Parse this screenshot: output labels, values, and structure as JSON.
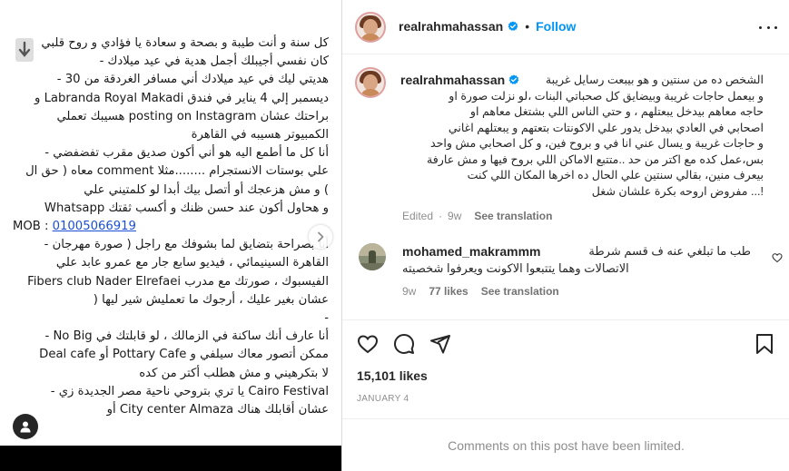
{
  "media": {
    "note_lines": [
      "كل سنة و أنت طيبة و بصحة و سعادة يا فؤادي و روح قلبي",
      "كان نفسي أجيبلك أجمل هدية في عيد ميلادك -",
      "هديتي ليك في عيد ميلادك أني مسافر الغردقة من 30 -",
      "ديسمبر إلي 4 يناير في فندق Labranda Royal Makadi و",
      "براحتك عشان posting on Instagram هسيبك تعملي",
      "الكمبيوتر هسيبه في القاهرة",
      "أنا كل ما أطمع اليه هو أني أكون صديق مقرب تفضفضي -",
      "علي بوستات الانستجرام ........مثلا comment معاه ( حق ال",
      ") و مش هزعجك أو أتصل بيك أبدا لو كلمتيني علي",
      "و هحاول أكون عند حسن ظنك و أكسب ثقتك  Whatsapp"
    ],
    "mob_label": "MOB : ",
    "mob_number": "01005066919",
    "note_lines_2": [
      "أنا بصراحة بتضايق لما بشوفك مع راجل ( صورة مهرجان -",
      "القاهرة السينيمائي ، فيديو سابع جار مع عمرو عابد علي",
      "الفيسبوك ، صورتك مع مدرب Fibers club Nader Elrefaei",
      "عشان بغير عليك ، أرجوك ما تعمليش شير ليها (",
      "-",
      "أنا عارف أنك ساكنة في الزمالك ، لو قابلتك في No Big -",
      "ممكن أتصور معاك سيلفي و  Pottary Cafe  أو  Deal cafe",
      "لا بتكرهيني و مش هطلب أكتر من كده",
      "Cairo Festival يا تري بتروحي ناحية مصر الجديدة زي -",
      "عشان أقابلك هناك  City center Almaza  أو"
    ]
  },
  "header": {
    "username": "realrahmahassan",
    "follow_label": "Follow",
    "separator": "•"
  },
  "caption": {
    "username": "realrahmahassan",
    "lines": [
      "الشخص ده من سنتين و هو بيبعت رسايل غريبة",
      "و بيعمل حاجات غريبة وبيضايق كل صحباتي البنات ،لو نزلت صورة او",
      "حاجه معاهم بيدخل يبعتلهم ، و حتي الناس اللي بشتغل معاهم او",
      "اصحابي في العادي بيدخل يدور علي الاكونتات بتعتهم و يبعتلهم اغاني",
      "و حاجات غريبة و يسال عني انا في و بروح فين، و كل اصحابي مش واحد",
      "بس،عمل كده مع اكتر من حد ..متتبع الاماكن اللي بروح فيها و مش عارفة",
      "بيعرف منين، بقالي سنتين علي الحال ده اخرها المكان اللي كنت",
      "!... مفروض اروحه بكرة علشان شغل"
    ],
    "edited_label": "Edited",
    "age": "9w",
    "see_translation": "See translation"
  },
  "comment": {
    "username": "mohamed_makrammm",
    "text_line_1": "طب ما تبلغي عنه ف قسم شرطة",
    "text_line_2": "الاتصالات وهما يتتبعوا الاكونت ويعرفوا شخصيته",
    "age": "9w",
    "likes": "77 likes",
    "see_translation": "See translation"
  },
  "engagement": {
    "likes": "15,101 likes",
    "date": "JANUARY 4"
  },
  "comments_limited": "Comments on this post have been limited.",
  "icons": {
    "like": "heart-icon",
    "comment": "comment-icon",
    "share": "paper-plane-icon",
    "save": "bookmark-icon",
    "more": "more-dots-icon",
    "verified": "verified-badge-icon",
    "next": "chevron-right-icon",
    "tag": "user-tag-icon"
  },
  "colors": {
    "link_blue": "#0095f6",
    "verified_blue": "#0095f6",
    "muted": "#8e8e8e"
  }
}
